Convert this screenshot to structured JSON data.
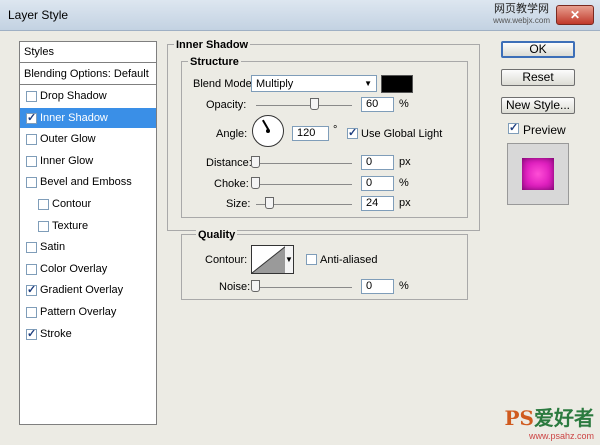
{
  "window": {
    "title": "Layer Style",
    "close_glyph": "✕"
  },
  "watermark_top": {
    "line1": "网页教学网",
    "line2": "www.webjx.com"
  },
  "watermark_bottom": {
    "line1_ps": "PS",
    "line1_rest": "爱好者",
    "line2": "www.psahz.com"
  },
  "left_panel": {
    "header": "Styles",
    "blending": "Blending Options: Default",
    "items": [
      {
        "label": "Drop Shadow",
        "checked": false,
        "indent": false
      },
      {
        "label": "Inner Shadow",
        "checked": true,
        "indent": false,
        "selected": true
      },
      {
        "label": "Outer Glow",
        "checked": false,
        "indent": false
      },
      {
        "label": "Inner Glow",
        "checked": false,
        "indent": false
      },
      {
        "label": "Bevel and Emboss",
        "checked": false,
        "indent": false
      },
      {
        "label": "Contour",
        "checked": false,
        "indent": true
      },
      {
        "label": "Texture",
        "checked": false,
        "indent": true
      },
      {
        "label": "Satin",
        "checked": false,
        "indent": false
      },
      {
        "label": "Color Overlay",
        "checked": false,
        "indent": false
      },
      {
        "label": "Gradient Overlay",
        "checked": true,
        "indent": false
      },
      {
        "label": "Pattern Overlay",
        "checked": false,
        "indent": false
      },
      {
        "label": "Stroke",
        "checked": true,
        "indent": false
      }
    ]
  },
  "inner_shadow": {
    "section_title": "Inner Shadow",
    "structure_title": "Structure",
    "blend_mode_label": "Blend Mode:",
    "blend_mode_value": "Multiply",
    "shadow_color": "#000000",
    "opacity_label": "Opacity:",
    "opacity_value": "60",
    "opacity_unit": "%",
    "opacity_fraction": 0.6,
    "angle_label": "Angle:",
    "angle_value": "120",
    "angle_unit": "°",
    "use_global_light_label": "Use Global Light",
    "use_global_light_checked": true,
    "distance_label": "Distance:",
    "distance_value": "0",
    "distance_unit": "px",
    "choke_label": "Choke:",
    "choke_value": "0",
    "choke_unit": "%",
    "size_label": "Size:",
    "size_value": "24",
    "size_unit": "px"
  },
  "quality": {
    "title": "Quality",
    "contour_label": "Contour:",
    "anti_aliased_label": "Anti-aliased",
    "anti_aliased_checked": false,
    "noise_label": "Noise:",
    "noise_value": "0",
    "noise_unit": "%"
  },
  "buttons": {
    "ok": "OK",
    "reset": "Reset",
    "new_style": "New Style...",
    "preview_label": "Preview",
    "preview_checked": true
  },
  "preview_color": "#e020c0"
}
